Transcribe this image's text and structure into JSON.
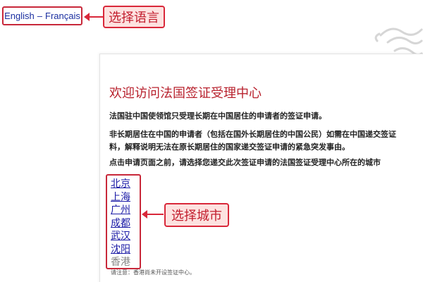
{
  "language": {
    "english": "English",
    "separator": "–",
    "french": "Français"
  },
  "annotations": {
    "select_language": "选择语言",
    "select_city": "选择城市"
  },
  "main": {
    "title": "欢迎访问法国签证受理中心",
    "paragraph1": "法国驻中国使领馆只受理长期在中国居住的申请者的签证申请。",
    "paragraph2_line1": "非长期居住在中国的申请者（包括在国外长期居住的中国公民）如需在中国递交签证",
    "paragraph2_line2": "料，解释说明无法在原长期居住的国家递交签证申请的紧急突发事由。",
    "paragraph3": "点击申请页面之前，请选择您递交此次签证申请的法国签证受理中心所在的城市",
    "cities": [
      "北京",
      "上海",
      "广州",
      "成都",
      "武汉",
      "沈阳",
      "香港"
    ],
    "note": "请注意：香港尚未开设签证中心。"
  },
  "colors": {
    "accent_red": "#d9283a",
    "link_blue": "#1a1aa6",
    "title_red": "#b8222e"
  }
}
